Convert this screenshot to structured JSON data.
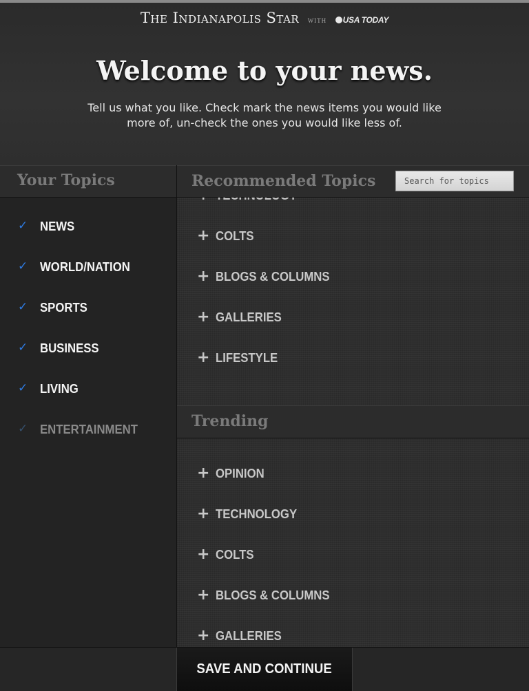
{
  "header": {
    "brand_name": "The Indianapolis Star",
    "brand_with": "with",
    "brand_partner": "USA TODAY",
    "welcome": "Welcome to your news.",
    "subtitle": "Tell us what you like. Check mark the news items you would like more of, un-check the ones you would like less of."
  },
  "your_topics": {
    "title": "Your Topics",
    "items": [
      {
        "label": "NEWS",
        "checked": true
      },
      {
        "label": "WORLD/NATION",
        "checked": true
      },
      {
        "label": "SPORTS",
        "checked": true
      },
      {
        "label": "BUSINESS",
        "checked": true
      },
      {
        "label": "LIVING",
        "checked": true
      },
      {
        "label": "ENTERTAINMENT",
        "checked": true,
        "faded": true
      }
    ]
  },
  "recommended": {
    "title": "Recommended Topics",
    "search_placeholder": "Search for topics",
    "items": [
      "TECHNOLOGY",
      "COLTS",
      "BLOGS & COLUMNS",
      "GALLERIES",
      "LIFESTYLE"
    ]
  },
  "trending": {
    "title": "Trending",
    "items": [
      "OPINION",
      "TECHNOLOGY",
      "COLTS",
      "BLOGS & COLUMNS",
      "GALLERIES"
    ]
  },
  "footer": {
    "save_label": "SAVE AND CONTINUE"
  },
  "icons": {
    "check": "checkmark-icon",
    "plus": "plus-icon"
  },
  "colors": {
    "check_blue": "#2e7be3",
    "background": "#2a2a2a"
  }
}
